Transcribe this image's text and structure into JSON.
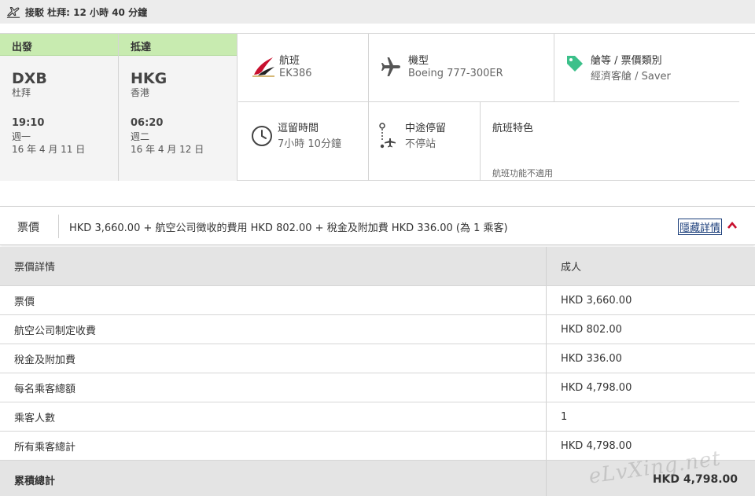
{
  "connection": {
    "icon": "transfer-plane-icon",
    "text": "接駁 杜拜: 12 小時 40 分鐘"
  },
  "departure": {
    "header": "出發",
    "code": "DXB",
    "city": "杜拜",
    "time": "19:10",
    "weekday": "週一",
    "date": "16 年 4 月 11 日"
  },
  "arrival": {
    "header": "抵達",
    "code": "HKG",
    "city": "香港",
    "time": "06:20",
    "weekday": "週二",
    "date": "16 年 4 月 12 日"
  },
  "flight": {
    "label": "航班",
    "value": "EK386",
    "icon": "emirates-logo-icon"
  },
  "aircraft": {
    "label": "機型",
    "value": "Boeing 777-300ER",
    "icon": "airplane-icon"
  },
  "cabin": {
    "label": "艙等 / 票價類別",
    "value": "經濟客艙 / Saver",
    "icon": "tag-icon",
    "icon_color": "#3cc08a"
  },
  "duration": {
    "label": "逗留時間",
    "value": "7小時 10分鐘",
    "icon": "clock-icon"
  },
  "stops": {
    "label": "中途停留",
    "value": "不停站",
    "icon": "route-stop-icon"
  },
  "features": {
    "label": "航班特色",
    "note": "航班功能不適用"
  },
  "fare_summary": {
    "title": "票價",
    "summary": "HKD 3,660.00 + 航空公司徵收的費用 HKD 802.00 + 稅金及附加費 HKD 336.00 (為 1 乘客)",
    "toggle_label": "隱藏詳情",
    "accent_color": "#c8102e"
  },
  "fare_table": {
    "header_left": "票價詳情",
    "header_right": "成人",
    "rows": [
      {
        "label": "票價",
        "value": "HKD 3,660.00"
      },
      {
        "label": "航空公司制定收費",
        "value": "HKD 802.00"
      },
      {
        "label": "稅金及附加費",
        "value": "HKD 336.00"
      },
      {
        "label": "每名乘客總額",
        "value": "HKD 4,798.00"
      },
      {
        "label": "乘客人數",
        "value": "1"
      },
      {
        "label": "所有乘客總計",
        "value": "HKD 4,798.00"
      }
    ],
    "total_label": "累積總計",
    "total_value": "HKD 4,798.00"
  },
  "watermark": "eLvXing.net"
}
